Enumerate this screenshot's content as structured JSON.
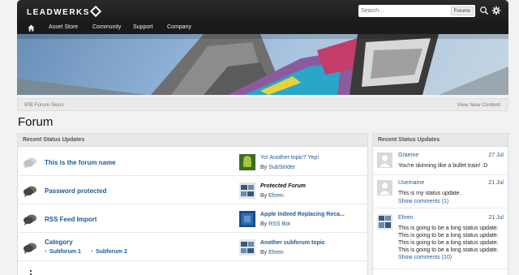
{
  "header": {
    "logo": "LEADWERKS",
    "search_placeholder": "Search...",
    "search_scope": "Forums"
  },
  "nav": {
    "items": [
      "Asset Store",
      "Community",
      "Support",
      "Company"
    ]
  },
  "breadcrumb": {
    "item": "IPB Forum Skins",
    "view_new": "View New Content"
  },
  "page_title": "Forum",
  "forum_panel": {
    "heading": "Recent Status Updates",
    "forums": [
      {
        "name": "This is the forum name",
        "last_title": "Yo! Another topic? Yep!",
        "last_by_prefix": "By ",
        "last_by": "SubStrider"
      },
      {
        "name": "Password protected",
        "last_title": "Protected Forum",
        "last_by_prefix": "By ",
        "last_by": "Ehren"
      },
      {
        "name": "RSS Feed Import",
        "last_title": "Apple Indeed Replacing Reca...",
        "last_by_prefix": "By ",
        "last_by": "RSS Bot"
      },
      {
        "name": "Category",
        "subforums": [
          "Subforum 1",
          "Subforum 2"
        ],
        "last_title": "Another subforum topic",
        "last_by_prefix": "By ",
        "last_by": "Ehren"
      }
    ]
  },
  "status_panel": {
    "heading": "Recent Status Updates",
    "items": [
      {
        "user": "Graeme",
        "date": "27 Jul",
        "text": "You're skinning like a bullet train! :D"
      },
      {
        "user": "Username",
        "date": "21 Jul",
        "text": "This is my status update.",
        "link": "Show comments (1)"
      },
      {
        "user": "Ehren",
        "date": "21 Jul",
        "text": "This is going to be a long status update. This is going to be a long status update. This is going to be a long status update. This is going to be a long status update.",
        "link": "Show comments (10)"
      }
    ]
  },
  "colors": {
    "link": "#1f5a94",
    "header": "#1c1c1c"
  }
}
